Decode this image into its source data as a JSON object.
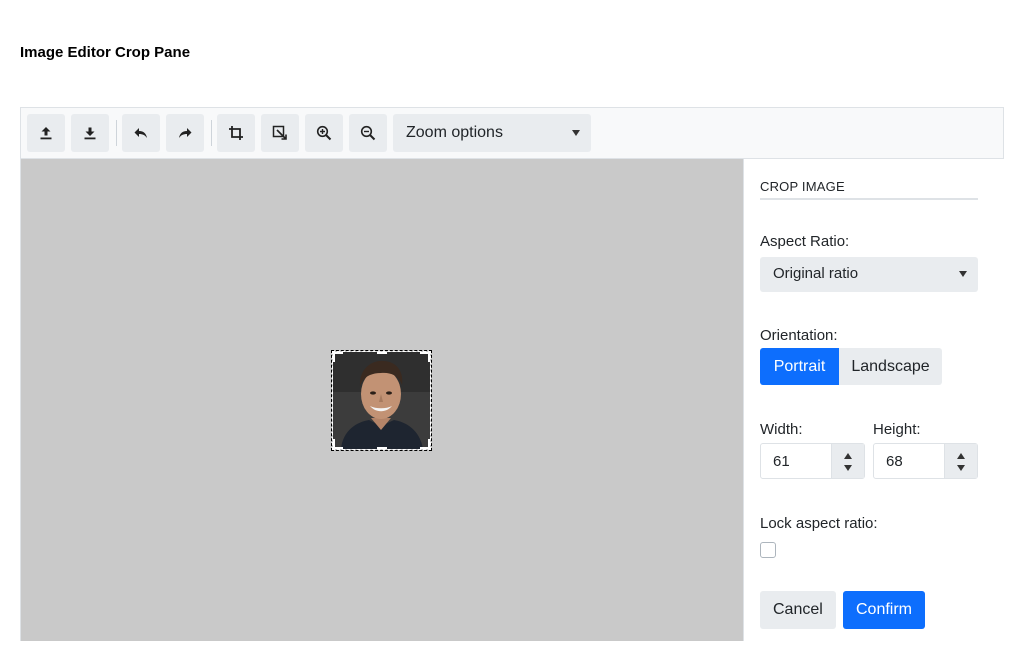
{
  "page": {
    "title": "Image Editor Crop Pane"
  },
  "toolbar": {
    "buttons": [
      {
        "name": "upload-icon"
      },
      {
        "name": "download-icon"
      },
      {
        "name": "undo-icon"
      },
      {
        "name": "redo-icon"
      },
      {
        "name": "crop-icon"
      },
      {
        "name": "resize-icon"
      },
      {
        "name": "zoom-in-icon"
      },
      {
        "name": "zoom-out-icon"
      }
    ],
    "zoom_select": {
      "value": "Zoom options"
    }
  },
  "crop_pane": {
    "heading": "CROP IMAGE",
    "aspect_ratio": {
      "label": "Aspect Ratio:",
      "value": "Original ratio"
    },
    "orientation": {
      "label": "Orientation:",
      "options": [
        "Portrait",
        "Landscape"
      ],
      "selected": "Portrait"
    },
    "width": {
      "label": "Width:",
      "value": "61"
    },
    "height": {
      "label": "Height:",
      "value": "68"
    },
    "lock_aspect": {
      "label": "Lock aspect ratio:",
      "checked": false
    },
    "cancel_label": "Cancel",
    "confirm_label": "Confirm"
  },
  "colors": {
    "accent": "#0d6efd",
    "canvas_bg": "#c9c9c9",
    "button_bg": "#e9ecef"
  }
}
